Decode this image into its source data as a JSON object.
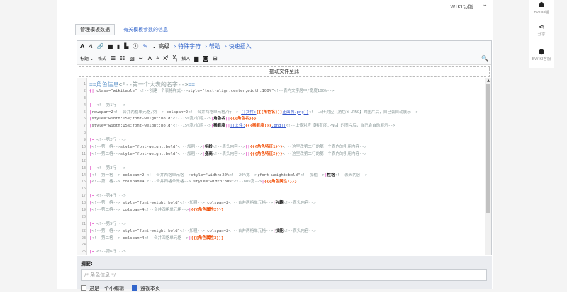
{
  "header": {
    "wiki_functions": "WIKI功能"
  },
  "tabs": {
    "manage_template_data": "管理模板数据",
    "template_params_info": "有关模板参数的信息"
  },
  "toolbar": {
    "row1": {
      "bold": "A",
      "italic": "A",
      "advanced": "高级",
      "special_chars": "特殊字符",
      "help": "帮助",
      "quick_insert": "快速插入"
    },
    "row2": {
      "heading": "标题",
      "format": "格式",
      "insert": "插入",
      "superscript": "X",
      "subscript": "X",
      "big": "A",
      "small": "A"
    }
  },
  "dropzone": "拖动文件至此",
  "code_lines": [
    {
      "n": "1",
      "h": true,
      "s": [
        [
          "h",
          "==角色信息"
        ],
        [
          "c",
          "<!--第一个大表的名字-->"
        ],
        [
          "h",
          "=="
        ]
      ]
    },
    {
      "n": "2",
      "s": [
        [
          "p",
          "{|"
        ],
        [
          "k",
          " class=\"wikitable\" "
        ],
        [
          "c",
          "<!--创建一个表格样式-->"
        ],
        [
          "k",
          "style=\"text-align:center;width:100%\""
        ],
        [
          "c",
          "<!--表内文字居中/宽度100%-->"
        ]
      ]
    },
    {
      "n": "3",
      "s": []
    },
    {
      "n": "4",
      "s": [
        [
          "p",
          "|-"
        ],
        [
          "c",
          " <!--第1行 -->"
        ]
      ]
    },
    {
      "n": "5",
      "s": [
        [
          "p",
          "|"
        ],
        [
          "k",
          "rowspan=2"
        ],
        [
          "c",
          "<!--合并两格单元格/列-->"
        ],
        [
          "k",
          " colspan=2"
        ],
        [
          "c",
          "<!--合并两格单元格/行-->"
        ],
        [
          "p",
          "|"
        ],
        [
          "l",
          "[[文件:"
        ],
        [
          "t",
          "{{{角色名}}}"
        ],
        [
          "l",
          "正面照.png]]"
        ],
        [
          "c",
          "<!--上传对应【角色名.PNG】的图片后，自己会自动展示-->"
        ]
      ]
    },
    {
      "n": "6",
      "s": [
        [
          "p",
          "|"
        ],
        [
          "k",
          "style=\"width:15%;font-weight:bold\""
        ],
        [
          "c",
          "<!--15%宽/加粗-->"
        ],
        [
          "p",
          "|"
        ],
        [
          "b",
          "角色名"
        ],
        [
          "p",
          "||"
        ],
        [
          "t",
          "{{{角色名}}}"
        ]
      ]
    },
    {
      "n": "7",
      "s": [
        [
          "p",
          "|"
        ],
        [
          "k",
          "style=\"width:15%;font-weight:bold\""
        ],
        [
          "c",
          "<!--15%宽/加粗-->"
        ],
        [
          "p",
          "|"
        ],
        [
          "b",
          "稀有度"
        ],
        [
          "p",
          "||"
        ],
        [
          "l",
          "[[文件:"
        ],
        [
          "t",
          "{{{稀有度}}}"
        ],
        [
          "l",
          ".png]]"
        ],
        [
          "c",
          "<!--上传对应【稀有度.PNG】的图片后，自己会自动展示-->"
        ]
      ]
    },
    {
      "n": "8",
      "s": []
    },
    {
      "n": "9",
      "s": [
        [
          "p",
          "|-"
        ],
        [
          "c",
          " <!--第2行 -->"
        ]
      ]
    },
    {
      "n": "10",
      "s": [
        [
          "p",
          "|"
        ],
        [
          "c",
          "<!--第一格-->"
        ],
        [
          "k",
          "style=\"font-weight:bold\""
        ],
        [
          "c",
          "<!--加粗-->"
        ],
        [
          "p",
          "|"
        ],
        [
          "b",
          "年龄"
        ],
        [
          "c",
          "<!--表头内容-->"
        ],
        [
          "p",
          "||"
        ],
        [
          "t",
          "{{{角色特征1}}}"
        ],
        [
          "c",
          "<!--这里改第二行的第一个表内的引用内容-->"
        ]
      ]
    },
    {
      "n": "11",
      "s": [
        [
          "p",
          "|"
        ],
        [
          "c",
          "<!--第二格-->"
        ],
        [
          "k",
          "style=\"font-weight:bold\""
        ],
        [
          "c",
          "<!--加粗-->"
        ],
        [
          "p",
          "|"
        ],
        [
          "b",
          "身高"
        ],
        [
          "c",
          "<!--表头内容-->"
        ],
        [
          "p",
          "||"
        ],
        [
          "t",
          "{{{角色特征2}}}"
        ],
        [
          "c",
          "<!--这里改第二行的第一个表内的引用内容-->"
        ]
      ]
    },
    {
      "n": "12",
      "s": []
    },
    {
      "n": "13",
      "s": [
        [
          "p",
          "|-"
        ],
        [
          "c",
          " <!--第3行 -->"
        ]
      ]
    },
    {
      "n": "14",
      "s": [
        [
          "p",
          "|"
        ],
        [
          "c",
          "<!--第一格-->"
        ],
        [
          "k",
          " colspan=2 "
        ],
        [
          "c",
          "<!--合并两格单元格-->"
        ],
        [
          "k",
          "style=\"width:20%"
        ],
        [
          "c",
          "<!--20%宽-->"
        ],
        [
          "k",
          ";font-weight:bold\""
        ],
        [
          "c",
          "<!--加粗-->"
        ],
        [
          "p",
          "|"
        ],
        [
          "b",
          "性格"
        ],
        [
          "c",
          "<!--表头内容-->"
        ]
      ]
    },
    {
      "n": "15",
      "s": [
        [
          "p",
          "|"
        ],
        [
          "c",
          "<!--第二格-->"
        ],
        [
          "k",
          " colspan=4 "
        ],
        [
          "c",
          "<!--合并四格单元格-->"
        ],
        [
          "k",
          " style=\"width:80%\""
        ],
        [
          "c",
          "<!--80%宽-->"
        ],
        [
          "p",
          "|"
        ],
        [
          "t",
          "{{{角色属性1}}}"
        ]
      ]
    },
    {
      "n": "16",
      "s": []
    },
    {
      "n": "17",
      "s": [
        [
          "p",
          "|-"
        ],
        [
          "c",
          " <!--第4行 -->"
        ]
      ]
    },
    {
      "n": "18",
      "s": [
        [
          "p",
          "|"
        ],
        [
          "c",
          "<!--第一格-->"
        ],
        [
          "k",
          " style=\"font-weight:bold\""
        ],
        [
          "c",
          "<!--加粗-->"
        ],
        [
          "k",
          " colspan=2"
        ],
        [
          "c",
          "<!--合并两格单元格-->"
        ],
        [
          "p",
          "|"
        ],
        [
          "b",
          "兴趣"
        ],
        [
          "c",
          "<!--表头内容-->"
        ]
      ]
    },
    {
      "n": "19",
      "s": [
        [
          "p",
          "|"
        ],
        [
          "c",
          "<!--第二格-->"
        ],
        [
          "k",
          "  colspan=4"
        ],
        [
          "c",
          "<!--合并四格单元格-->"
        ],
        [
          "p",
          "|"
        ],
        [
          "t",
          "{{{角色属性2}}}"
        ]
      ]
    },
    {
      "n": "20",
      "s": []
    },
    {
      "n": "21",
      "s": [
        [
          "p",
          "|-"
        ],
        [
          "c",
          " <!--第5行 -->"
        ]
      ]
    },
    {
      "n": "22",
      "s": [
        [
          "p",
          "|"
        ],
        [
          "c",
          "<!--第一格-->"
        ],
        [
          "k",
          " style=\"font-weight:bold\""
        ],
        [
          "c",
          "<!--加粗-->"
        ],
        [
          "k",
          " colspan=2"
        ],
        [
          "c",
          "<!--合并两格单元格-->"
        ],
        [
          "p",
          "|"
        ],
        [
          "b",
          "技能"
        ],
        [
          "c",
          "<!--表头内容-->"
        ]
      ]
    },
    {
      "n": "23",
      "s": [
        [
          "p",
          "|"
        ],
        [
          "c",
          "<!--第二格-->"
        ],
        [
          "k",
          "  colspan=4"
        ],
        [
          "c",
          "<!--合并四格单元格-->"
        ],
        [
          "p",
          "|"
        ],
        [
          "t",
          "{{{角色属性3}}}"
        ]
      ]
    },
    {
      "n": "24",
      "s": []
    },
    {
      "n": "25",
      "s": [
        [
          "p",
          "|-"
        ],
        [
          "c",
          " <!--第6行 -->"
        ]
      ]
    }
  ],
  "summary": {
    "label": "摘要:",
    "placeholder": "/* 角色信息 */"
  },
  "options": {
    "minor_edit": "这是一个小编辑",
    "watch_page": "监视本页",
    "minor_checked": false,
    "watch_checked": true
  },
  "sidebar": {
    "item1": "BWIKI喵",
    "share": "分享",
    "qq": "BWIKI客服"
  },
  "colors": {
    "link": "#3366cc",
    "pipe": "#e040c0",
    "template": "#f04a00",
    "comment": "#8a9999"
  }
}
